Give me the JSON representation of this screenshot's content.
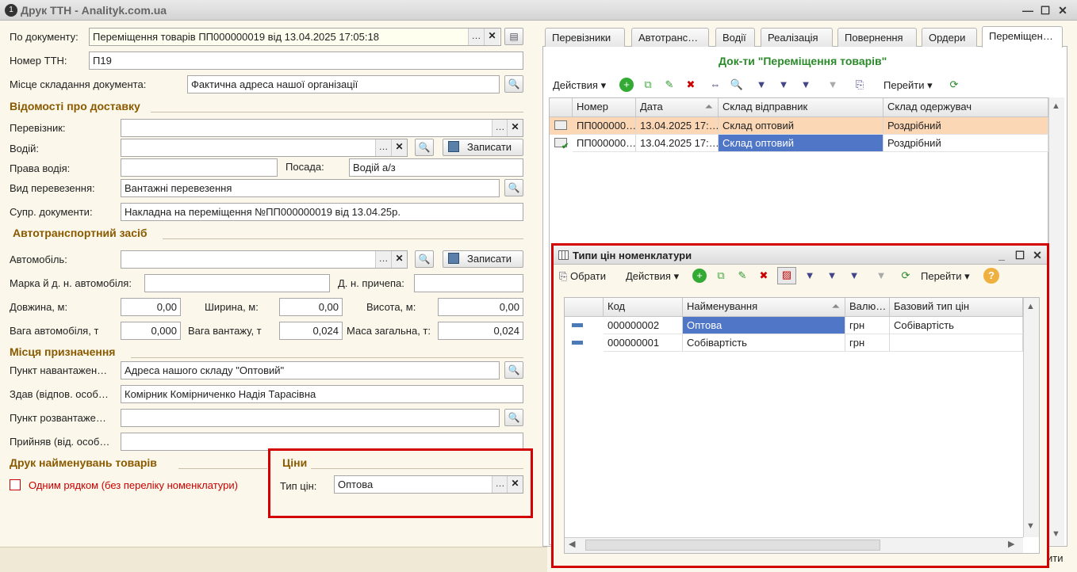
{
  "window": {
    "title": "Друк ТТН - Analityk.com.ua",
    "min_icon": "minimize-icon",
    "max_icon": "maximize-icon",
    "close_icon": "close-icon"
  },
  "form": {
    "doc_label": "По документу:",
    "doc_value": "Переміщення товарів ПП000000019 від 13.04.2025 17:05:18",
    "ttn_label": "Номер ТТН:",
    "ttn_value": "П19",
    "place_label": "Місце складання документа:",
    "place_value": "Фактична адреса нашої організації",
    "delivery_section": "Відомості про доставку",
    "carrier_label": "Перевізник:",
    "carrier_value": "",
    "driver_label": "Водій:",
    "driver_value": "",
    "save_label": "Записати",
    "license_label": "Права водія:",
    "license_value": "",
    "position_label": "Посада:",
    "position_value": "Водій а/з",
    "transport_type_label": "Вид перевезення:",
    "transport_type_value": "Вантажні перевезення",
    "docs_label": "Супр. документи:",
    "docs_value": "Накладна на переміщення №ПП000000019 від 13.04.25р.",
    "vehicle_section": "Автотранспортний засіб",
    "car_label": "Автомобіль:",
    "car_value": "",
    "make_label": "Марка й д. н. автомобіля:",
    "make_value": "",
    "trailer_label": "Д. н. причепа:",
    "trailer_value": "",
    "length_label": "Довжина, м:",
    "length_value": "0,00",
    "width_label": "Ширина, м:",
    "width_value": "0,00",
    "height_label": "Висота, м:",
    "height_value": "0,00",
    "car_weight_label": "Вага автомобіля, т",
    "car_weight_value": "0,000",
    "cargo_weight_label": "Вага вантажу, т",
    "cargo_weight_value": "0,024",
    "total_weight_label": "Маса загальна, т:",
    "total_weight_value": "0,024",
    "dest_section": "Місця призначення",
    "load_point_label": "Пункт навантажен…",
    "load_point_value": "Адреса нашого складу \"Оптовий\"",
    "handed_label": "Здав (відпов. особ…",
    "handed_value": "Комірник Комірниченко Надія Тарасівна",
    "unload_point_label": "Пункт розвантаже…",
    "unload_point_value": "",
    "received_label": "Прийняв (від. особ…",
    "received_value": "",
    "print_section": "Друк найменувань товарів",
    "one_line_label": "Одним рядком (без переліку номенклатури)",
    "prices_section": "Ціни",
    "price_type_label": "Тип цін:",
    "price_type_value": "Оптова"
  },
  "tabs": [
    "Перевізники",
    "Автотранс…",
    "Водії",
    "Реалізація",
    "Повернення",
    "Ордери",
    "Переміщен…"
  ],
  "right_panel": {
    "title": "Док-ти \"Переміщення товарів\"",
    "actions_label": "Действия",
    "goto_label": "Перейти",
    "columns": [
      "Номер",
      "Дата",
      "Склад відправник",
      "Склад одержувач"
    ],
    "rows": [
      {
        "number": "ПП000000…",
        "date": "13.04.2025 17:…",
        "sender": "Склад оптовий",
        "receiver": "Роздрібний"
      },
      {
        "number": "ПП000000…",
        "date": "13.04.2025 17:…",
        "sender": "Склад оптовий",
        "receiver": "Роздрібний"
      }
    ]
  },
  "dialog": {
    "title": "Типи цін номенклатури",
    "select_label": "Обрати",
    "actions_label": "Действия",
    "goto_label": "Перейти",
    "columns": [
      "Код",
      "Найменування",
      "Валю…",
      "Базовий тип цін"
    ],
    "rows": [
      {
        "code": "000000002",
        "name": "Оптова",
        "currency": "грн",
        "base": "Собівартість"
      },
      {
        "code": "000000001",
        "name": "Собівартість",
        "currency": "грн",
        "base": ""
      }
    ]
  },
  "bottom_partial": "ити",
  "colors": {
    "section": "#8a5a00",
    "accent_green": "#2a8a2a",
    "highlight_row": "#fbd7b6",
    "selected_cell": "#4f76c7",
    "red_box": "#d20000"
  }
}
